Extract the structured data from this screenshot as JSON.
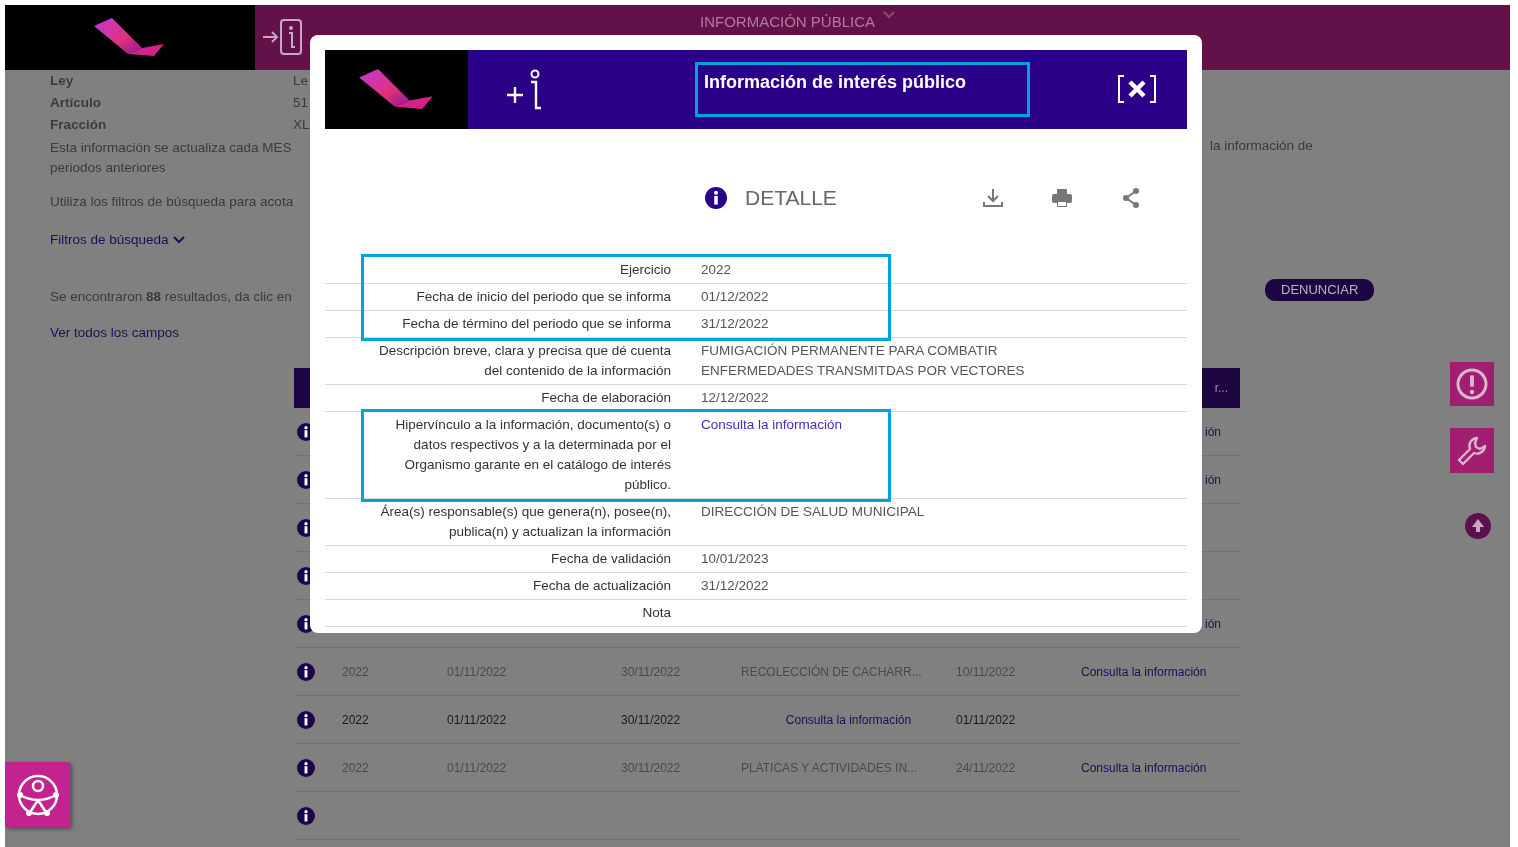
{
  "site_header": {
    "menu_label": "INFORMACIÓN PÚBLICA"
  },
  "background": {
    "fields": [
      {
        "label": "Ley",
        "value": "Le"
      },
      {
        "label": "Artículo",
        "value": "51"
      },
      {
        "label": "Fracción",
        "value": "XL"
      }
    ],
    "notice_lines": [
      "Esta información se actualiza cada MES",
      "periodos anteriores"
    ],
    "notice_tail": "la información de",
    "hint": "Utiliza los filtros de búsqueda para acota",
    "filters_label": "Filtros de búsqueda",
    "results_text": "Se encontraron **88** resultados, da clic en",
    "report_button": "DENUNCIAR",
    "all_fields_link": "Ver todos los campos",
    "table": {
      "header_fragment": "r...",
      "rows": [
        {
          "kind": "covered",
          "tail": "ión"
        },
        {
          "kind": "covered",
          "tail": "ión"
        },
        {
          "kind": "covered"
        },
        {
          "kind": "covered"
        },
        {
          "kind": "covered",
          "tail": "ión"
        },
        {
          "kind": "full",
          "emphasized": false,
          "year": "2022",
          "start": "01/11/2022",
          "end": "30/11/2022",
          "description": "RECOLECCIÓN DE CACHARR...",
          "description_is_link": false,
          "date": "10/11/2022",
          "link": "Consulta la información"
        },
        {
          "kind": "full",
          "emphasized": true,
          "year": "2022",
          "start": "01/11/2022",
          "end": "30/11/2022",
          "description": "Consulta la información",
          "description_is_link": true,
          "date": "01/11/2022"
        },
        {
          "kind": "full",
          "emphasized": false,
          "year": "2022",
          "start": "01/11/2022",
          "end": "30/11/2022",
          "description": "PLATICAS Y ACTIVIDADES IN...",
          "description_is_link": false,
          "date": "24/11/2022",
          "link": "Consulta la información"
        },
        {
          "kind": "cut"
        }
      ]
    }
  },
  "modal": {
    "title": "Información de interés público",
    "title_highlighted": true,
    "section": "DETALLE",
    "rows": [
      {
        "label": "Ejercicio",
        "value": "2022",
        "kind": "text",
        "highlighted": true
      },
      {
        "label": "Fecha de inicio del periodo que se informa",
        "value": "01/12/2022",
        "kind": "text",
        "highlighted": true
      },
      {
        "label": "Fecha de término del periodo que se informa",
        "value": "31/12/2022",
        "kind": "text",
        "highlighted": true
      },
      {
        "label": "Descripción breve, clara y precisa que dé cuenta del contenido de la información",
        "value": "FUMIGACIÓN PERMANENTE PARA COMBATIR ENFERMEDADES TRANSMITDAS POR VECTORES",
        "kind": "text",
        "highlighted": false
      },
      {
        "label": "Fecha de elaboración",
        "value": "12/12/2022",
        "kind": "text",
        "highlighted": false
      },
      {
        "label": "Hipervínculo a la información, documento(s) o datos respectivos y a la determinada por el Organismo garante en el catálogo de interés público.",
        "value": "Consulta la información",
        "kind": "link",
        "highlighted": true
      },
      {
        "label": "Área(s) responsable(s) que genera(n), posee(n), publica(n) y actualizan la información",
        "value": "DIRECCIÓN DE SALUD MUNICIPAL",
        "kind": "text",
        "highlighted": false
      },
      {
        "label": "Fecha de validación",
        "value": "10/01/2023",
        "kind": "text",
        "highlighted": false
      },
      {
        "label": "Fecha de actualización",
        "value": "31/12/2022",
        "kind": "text",
        "highlighted": false
      },
      {
        "label": "Nota",
        "highlighted": false
      }
    ]
  }
}
